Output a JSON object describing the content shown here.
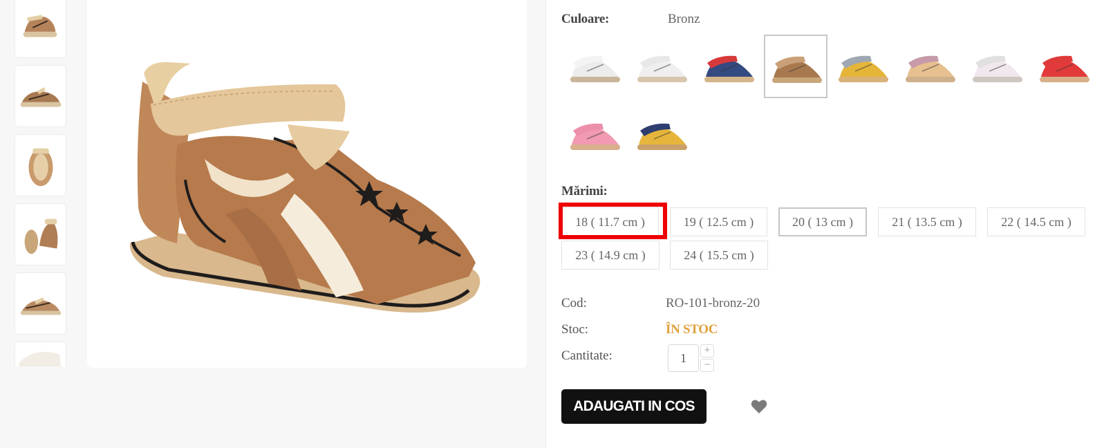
{
  "product": {
    "color_label": "Culoare:",
    "color_value": "Bronz",
    "sizes_label": "Mărimi:",
    "sizes": [
      "18 ( 11.7 cm )",
      "19 ( 12.5 cm )",
      "20 ( 13 cm )",
      "21 ( 13.5 cm )",
      "22 ( 14.5 cm )",
      "23 ( 14.9 cm )",
      "24 ( 15.5 cm )"
    ],
    "selected_size": "20 ( 13 cm )",
    "highlighted_size": "18 ( 11.7 cm )",
    "code_label": "Cod:",
    "code_value": "RO-101-bronz-20",
    "stock_label": "Stoc:",
    "stock_value": "ÎN STOC",
    "quantity_label": "Cantitate:",
    "quantity_value": "1",
    "increase_symbol": "+",
    "decrease_symbol": "−",
    "add_to_cart": "ADAUGATI IN COS"
  },
  "color_swatches": [
    {
      "strap": "#f4f4f4",
      "body": "#ececec",
      "sole": "#c9b59a",
      "selected": false
    },
    {
      "strap": "#e8e8e8",
      "body": "#efefef",
      "sole": "#d8c7ae",
      "selected": false
    },
    {
      "strap": "#d73a3a",
      "body": "#354a80",
      "sole": "#d4b48a",
      "selected": false
    },
    {
      "strap": "#caa078",
      "body": "#a8784e",
      "sole": "#c9a57a",
      "selected": true
    },
    {
      "strap": "#9fa8b2",
      "body": "#e5b53a",
      "sole": "#d9b27a",
      "selected": false
    },
    {
      "strap": "#c69aa8",
      "body": "#e7c090",
      "sole": "#cfb08c",
      "selected": false
    },
    {
      "strap": "#e0e0e0",
      "body": "#f0e8ee",
      "sole": "#cdc7c0",
      "selected": false
    },
    {
      "strap": "#df3b3b",
      "body": "#e23a3a",
      "sole": "#d7b08a",
      "selected": false
    },
    {
      "strap": "#ec8fa8",
      "body": "#f29ab2",
      "sole": "#d9b08c",
      "selected": false
    },
    {
      "strap": "#2f3e70",
      "body": "#e6b53c",
      "sole": "#c9a06b",
      "selected": false
    }
  ],
  "colors": {
    "accent_stock": "#e0a03b",
    "button_bg": "#111111",
    "highlight": "#ee0000"
  },
  "icons": {
    "wishlist": "heart-icon"
  }
}
